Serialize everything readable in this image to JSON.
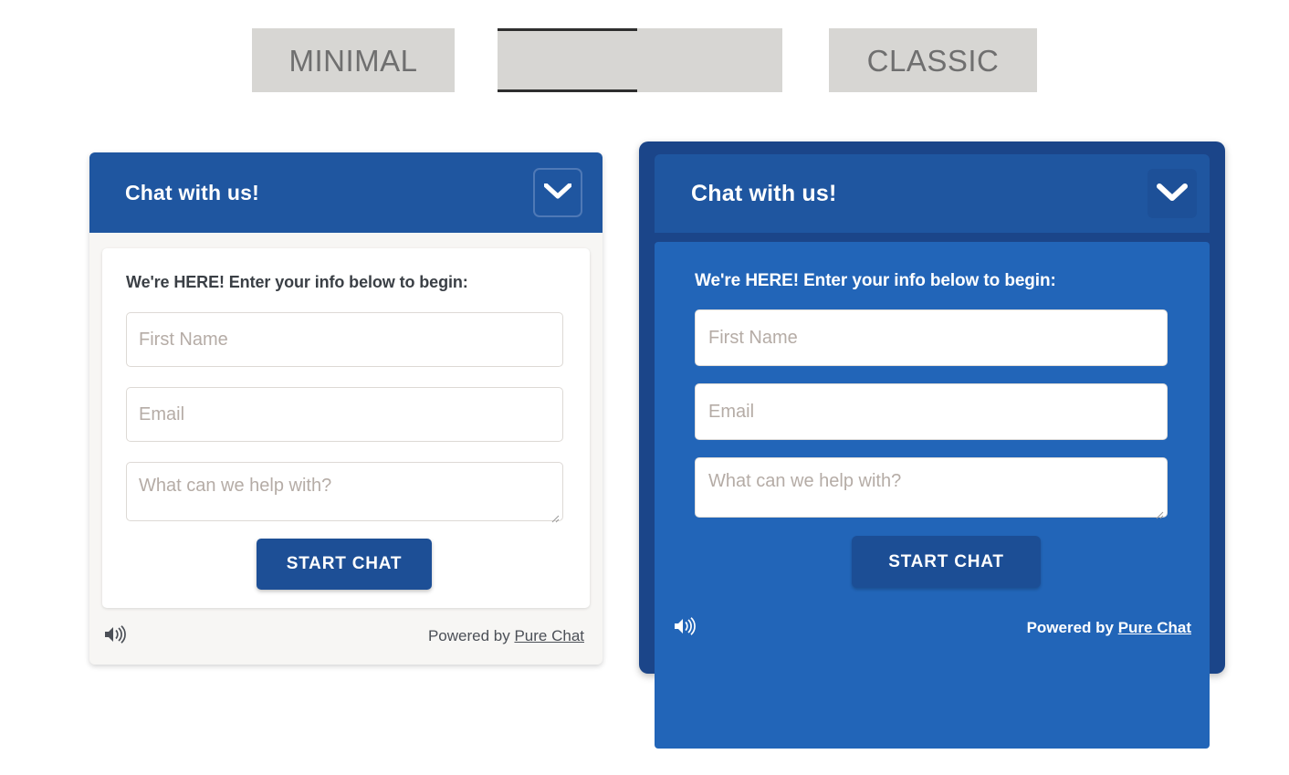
{
  "theme_tabs": [
    {
      "id": "minimal",
      "label": "MINIMAL"
    },
    {
      "id": "middle",
      "label": ""
    },
    {
      "id": "classic",
      "label": "CLASSIC"
    }
  ],
  "colors": {
    "header_blue": "#1F56A0",
    "classic_frame_blue": "#1B4589",
    "classic_panel_blue": "#2265B8",
    "button_blue": "#1D4F96",
    "tab_chip_gray": "#D7D6D3",
    "tab_label_gray": "#6F6F6F",
    "placeholder_gray": "#B5ACA6",
    "minimal_body": "#F7F6F4"
  },
  "minimal_widget": {
    "title": "Chat with us!",
    "collapse_icon": "chevron-down-icon",
    "intro": "We're HERE! Enter your info below to begin:",
    "fields": {
      "first_name_placeholder": "First Name",
      "email_placeholder": "Email",
      "message_placeholder": "What can we help with?"
    },
    "start_button_label": "START CHAT",
    "footer": {
      "sound_icon": "speaker-icon",
      "powered_prefix": "Powered by ",
      "powered_link": "Pure Chat"
    }
  },
  "classic_widget": {
    "title": "Chat with us!",
    "collapse_icon": "chevron-down-icon",
    "intro": "We're HERE! Enter your info below to begin:",
    "fields": {
      "first_name_placeholder": "First Name",
      "email_placeholder": "Email",
      "message_placeholder": "What can we help with?"
    },
    "start_button_label": "START CHAT",
    "footer": {
      "sound_icon": "speaker-icon",
      "powered_prefix": "Powered by ",
      "powered_link": "Pure Chat"
    }
  }
}
